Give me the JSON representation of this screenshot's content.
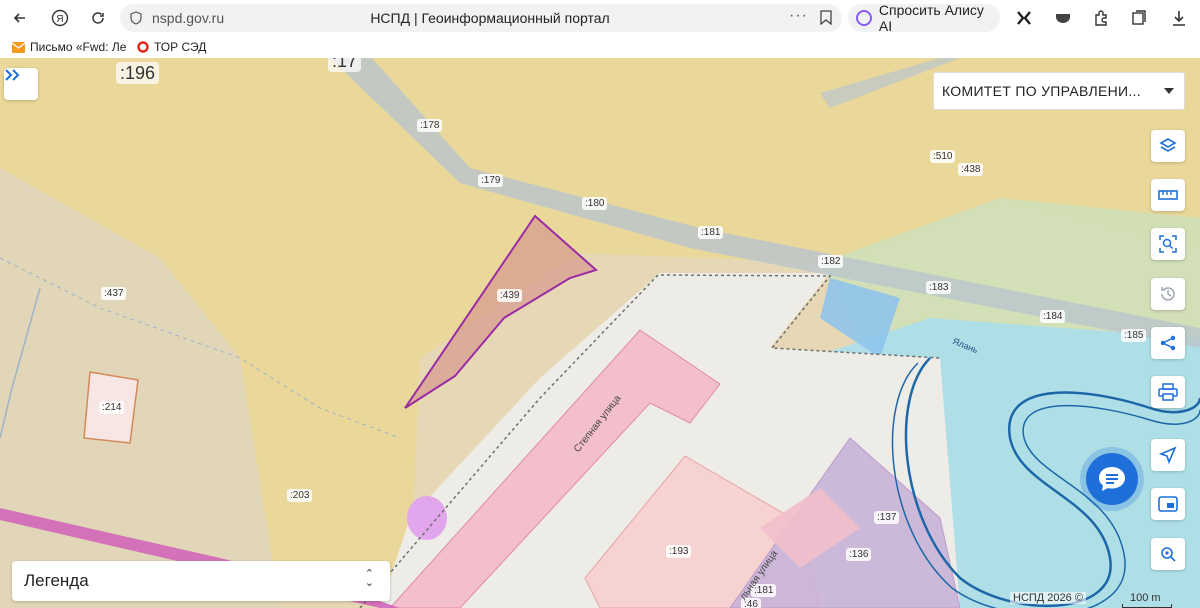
{
  "browser": {
    "url": "nspd.gov.ru",
    "title": "НСПД | Геоинформационный портал",
    "alice_button": "Спросить Алису AI",
    "bookmarks": [
      {
        "label": "Письмо «Fwd: Ле"
      },
      {
        "label": "ТОР СЭД"
      }
    ]
  },
  "map": {
    "agency_select": "КОМИТЕТ ПО УПРАВЛЕНИ...",
    "legend_label": "Легенда",
    "copyright": "НСПД 2026 ©",
    "scale": "100 m",
    "big_labels": [
      ":196",
      ":17"
    ],
    "parcel_labels": [
      ":178",
      ":179",
      ":180",
      ":181",
      ":182",
      ":183",
      ":184",
      ":185",
      ":510",
      ":438",
      ":437",
      ":439",
      ":214",
      ":203",
      ":193",
      ":137",
      ":136",
      ":181",
      ":46"
    ],
    "street_labels": [
      "Степная улица",
      "льная улица",
      "Ялань"
    ],
    "colors": {
      "land_yellow": "#e9d79a",
      "land_tan": "#e6d8b4",
      "residential_pink": "#f2bfcb",
      "industrial_purple": "#c9b4d8",
      "water_blue": "#a8dff0",
      "selected_parcel": "#9a2aa5",
      "accent_blue": "#1e6fd9"
    }
  },
  "tools": [
    {
      "name": "layers-icon"
    },
    {
      "name": "ruler-icon"
    },
    {
      "name": "area-search-icon"
    },
    {
      "name": "history-icon"
    },
    {
      "name": "share-icon"
    },
    {
      "name": "print-icon"
    },
    {
      "name": "locate-icon"
    },
    {
      "name": "minimap-icon"
    },
    {
      "name": "geo-search-icon"
    }
  ]
}
